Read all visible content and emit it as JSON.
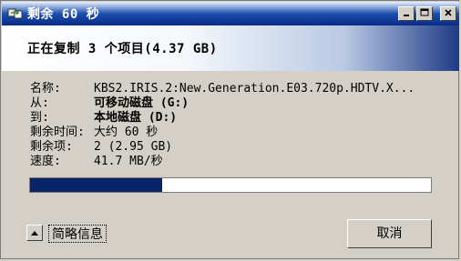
{
  "window": {
    "title": "剩余 60 秒"
  },
  "header": {
    "text": "正在复制 3 个项目(4.37 GB)"
  },
  "info": {
    "rows": [
      {
        "key": "名称:",
        "value": "KBS2.IRIS.2:New.Generation.E03.720p.HDTV.X...",
        "bold": false
      },
      {
        "key": "从:",
        "value": "可移动磁盘 (G:)",
        "bold": true
      },
      {
        "key": "到:",
        "value": "本地磁盘 (D:)",
        "bold": true
      },
      {
        "key": "剩余时间:",
        "value": "大约 60 秒",
        "bold": false
      },
      {
        "key": "剩余项:",
        "value": "2 (2.95 GB)",
        "bold": false
      },
      {
        "key": "速度:",
        "value": "41.7 MB/秒",
        "bold": false
      }
    ]
  },
  "progress": {
    "fraction": 0.33,
    "color": "#0a246a"
  },
  "footer": {
    "details_label": "简略信息",
    "cancel_label": "取消"
  },
  "icons": {
    "app": "copy-icon",
    "minimize": "minimize-icon",
    "maximize": "maximize-icon",
    "close": "close-icon",
    "details": "chevron-up-icon"
  }
}
